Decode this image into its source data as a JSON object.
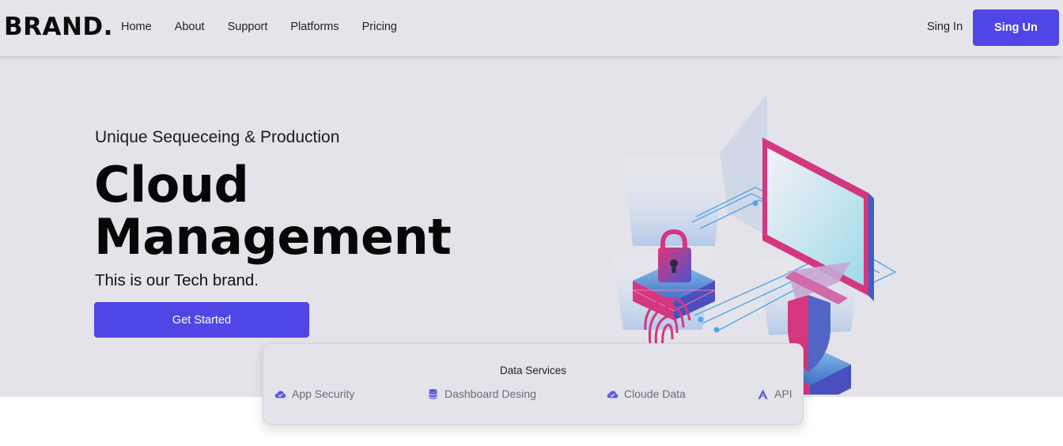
{
  "nav": {
    "brand": "BRAND.",
    "links": [
      "Home",
      "About",
      "Support",
      "Platforms",
      "Pricing"
    ],
    "signin": "Sing In",
    "signup": "Sing Un"
  },
  "hero": {
    "subtitle": "Unique Sequeceing & Production",
    "title_line1": "Cloud",
    "title_line2": "Management",
    "tagline": "This is our Tech brand.",
    "cta": "Get Started"
  },
  "services": {
    "title": "Data Services",
    "items": [
      {
        "label": "App Security",
        "icon": "cloud-check-icon"
      },
      {
        "label": "Dashboard Desing",
        "icon": "database-icon"
      },
      {
        "label": "Cloude Data",
        "icon": "cloud-check-icon"
      },
      {
        "label": "API",
        "icon": "api-a-icon"
      }
    ]
  },
  "colors": {
    "accent": "#4f46e5",
    "background": "#e4e3e9",
    "illustration_pink": "#d4377f",
    "illustration_blue": "#3a6fd4"
  }
}
